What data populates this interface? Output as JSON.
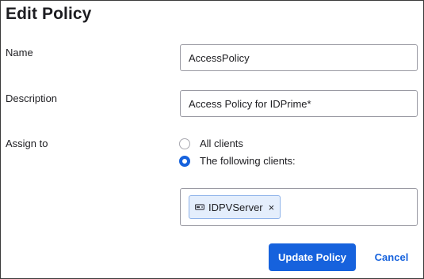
{
  "dialog": {
    "title": "Edit Policy"
  },
  "form": {
    "name": {
      "label": "Name",
      "value": "AccessPolicy"
    },
    "description": {
      "label": "Description",
      "value": "Access Policy for IDPrime*"
    },
    "assign_to": {
      "label": "Assign to",
      "options": [
        {
          "label": "All clients",
          "selected": false
        },
        {
          "label": "The following clients:",
          "selected": true
        }
      ],
      "clients": [
        {
          "label": "IDPVServer",
          "icon": "server-icon",
          "remove_glyph": "×"
        }
      ]
    }
  },
  "actions": {
    "update_label": "Update Policy",
    "cancel_label": "Cancel"
  },
  "colors": {
    "accent": "#1662dd",
    "chip_background": "#e4eefc",
    "chip_border": "#8fb3ea",
    "field_border": "#9a9aa3",
    "text": "#1d1d21"
  }
}
